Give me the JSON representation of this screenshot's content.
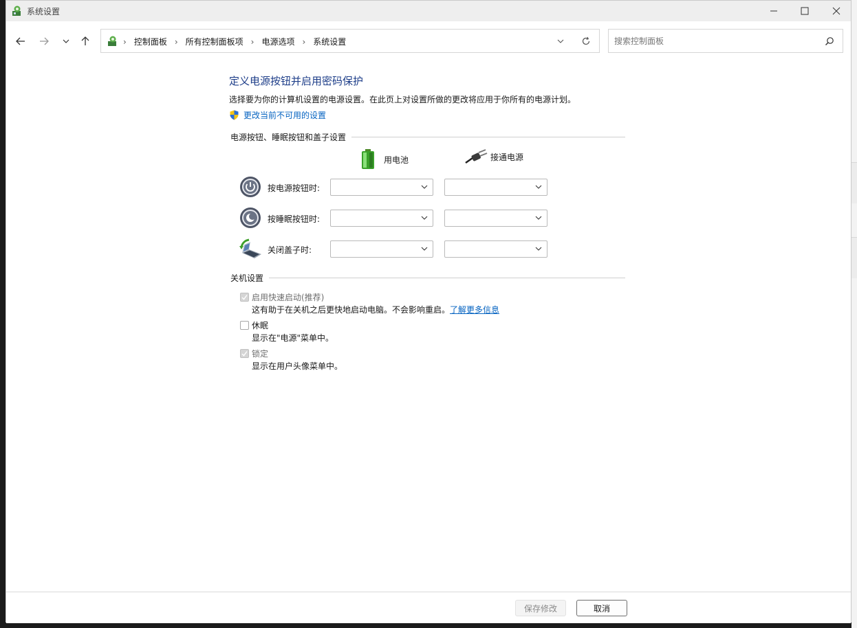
{
  "window": {
    "title": "系统设置",
    "controls": {
      "minimize": "—",
      "maximize": "☐",
      "close": "✕"
    }
  },
  "nav": {
    "back_icon": "←",
    "forward_icon": "→",
    "recent_icon": "⌄",
    "up_icon": "↑",
    "breadcrumbs": [
      "控制面板",
      "所有控制面板项",
      "电源选项",
      "系统设置"
    ],
    "separator": "›",
    "refresh_icon": "⟳",
    "search": {
      "placeholder": "搜索控制面板",
      "value": ""
    }
  },
  "page": {
    "title": "定义电源按钮并启用密码保护",
    "description": "选择要为你的计算机设置的电源设置。在此页上对设置所做的更改将应用于你所有的电源计划。",
    "change_link": "更改当前不可用的设置"
  },
  "power_section": {
    "heading": "电源按钮、睡眠按钮和盖子设置",
    "columns": {
      "battery": "用电池",
      "plugged": "接通电源"
    },
    "rows": [
      {
        "label": "按电源按钮时:",
        "battery_value": "",
        "plugged_value": ""
      },
      {
        "label": "按睡眠按钮时:",
        "battery_value": "",
        "plugged_value": ""
      },
      {
        "label": "关闭盖子时:",
        "battery_value": "",
        "plugged_value": ""
      }
    ]
  },
  "shutdown_section": {
    "heading": "关机设置",
    "options": [
      {
        "label": "启用快速启动(推荐)",
        "checked": true,
        "disabled": true,
        "desc": "这有助于在关机之后更快地启动电脑。不会影响重启。",
        "desc_link": "了解更多信息"
      },
      {
        "label": "休眠",
        "checked": false,
        "disabled": false,
        "desc": "显示在\"电源\"菜单中。",
        "desc_link": ""
      },
      {
        "label": "锁定",
        "checked": true,
        "disabled": true,
        "desc": "显示在用户头像菜单中。",
        "desc_link": ""
      }
    ]
  },
  "footer": {
    "save_label": "保存修改",
    "cancel_label": "取消"
  },
  "colors": {
    "title_blue": "#1e3e89",
    "link_blue": "#0563c1"
  }
}
